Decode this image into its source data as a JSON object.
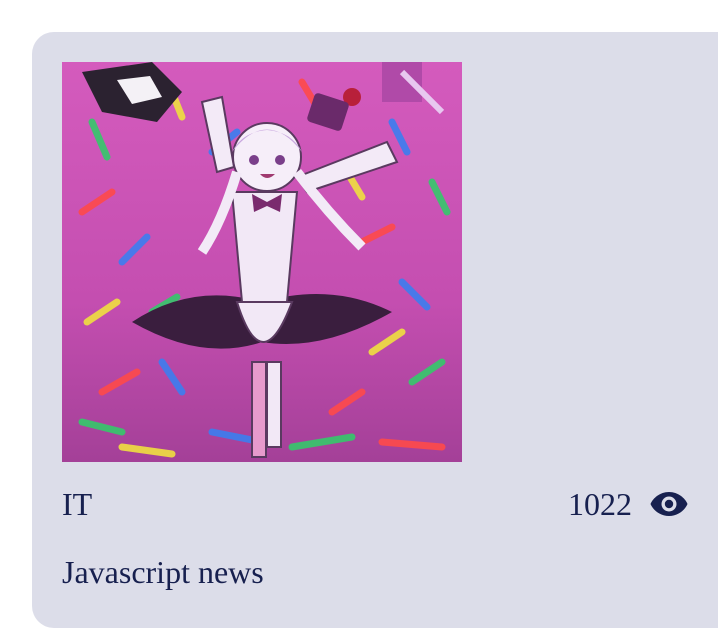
{
  "card": {
    "category": "IT",
    "views": "1022",
    "title": "Javascript news",
    "image_alt": "cartoon character celebrating in confetti"
  },
  "icons": {
    "views": "eye-icon"
  },
  "colors": {
    "card_background": "#dcdde9",
    "text": "#17204f",
    "image_background": "#c74fb0"
  }
}
